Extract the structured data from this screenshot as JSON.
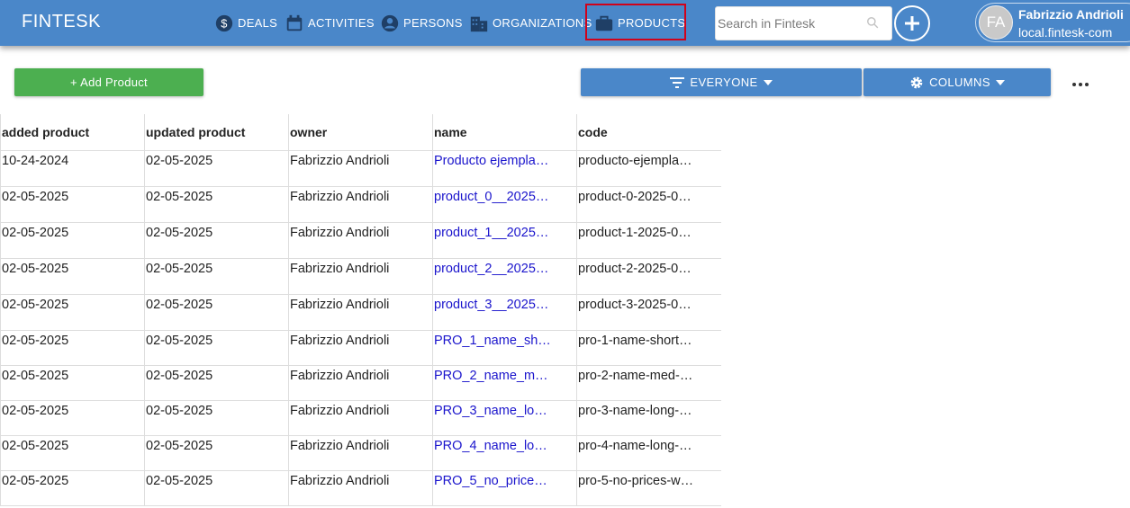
{
  "app": {
    "brand": "FINTESK"
  },
  "nav": [
    {
      "label": "DEALS",
      "icon": "dollar-circle-icon"
    },
    {
      "label": "ACTIVITIES",
      "icon": "calendar-icon"
    },
    {
      "label": "PERSONS",
      "icon": "person-icon"
    },
    {
      "label": "ORGANIZATIONS",
      "icon": "building-icon"
    },
    {
      "label": "PRODUCTS",
      "icon": "briefcase-icon",
      "highlighted": true
    }
  ],
  "search": {
    "placeholder": "Search in Fintesk",
    "value": ""
  },
  "user": {
    "initials": "FA",
    "name": "Fabrizzio Andrioli",
    "domain": "local.fintesk-com"
  },
  "toolbar": {
    "add_product_label": "+ Add Product",
    "filter_label": "EVERYONE",
    "columns_label": "COLUMNS"
  },
  "colors": {
    "topbar": "#4a87c9",
    "add_button": "#4caf50",
    "link": "#1a14cc",
    "highlight": "#d0021b"
  },
  "table": {
    "columns": [
      "added product",
      "updated product",
      "owner",
      "name",
      "code"
    ],
    "rows": [
      [
        "10-24-2024",
        "02-05-2025",
        "Fabrizzio Andrioli",
        "Producto ejempla…",
        "producto-ejempla…"
      ],
      [
        "02-05-2025",
        "02-05-2025",
        "Fabrizzio Andrioli",
        "product_0__2025…",
        "product-0-2025-0…"
      ],
      [
        "02-05-2025",
        "02-05-2025",
        "Fabrizzio Andrioli",
        "product_1__2025…",
        "product-1-2025-0…"
      ],
      [
        "02-05-2025",
        "02-05-2025",
        "Fabrizzio Andrioli",
        "product_2__2025…",
        "product-2-2025-0…"
      ],
      [
        "02-05-2025",
        "02-05-2025",
        "Fabrizzio Andrioli",
        "product_3__2025…",
        "product-3-2025-0…"
      ],
      [
        "02-05-2025",
        "02-05-2025",
        "Fabrizzio Andrioli",
        "PRO_1_name_sh…",
        "pro-1-name-short…"
      ],
      [
        "02-05-2025",
        "02-05-2025",
        "Fabrizzio Andrioli",
        "PRO_2_name_m…",
        "pro-2-name-med-…"
      ],
      [
        "02-05-2025",
        "02-05-2025",
        "Fabrizzio Andrioli",
        "PRO_3_name_lo…",
        "pro-3-name-long-…"
      ],
      [
        "02-05-2025",
        "02-05-2025",
        "Fabrizzio Andrioli",
        "PRO_4_name_lo…",
        "pro-4-name-long-…"
      ],
      [
        "02-05-2025",
        "02-05-2025",
        "Fabrizzio Andrioli",
        "PRO_5_no_price…",
        "pro-5-no-prices-w…"
      ]
    ]
  }
}
